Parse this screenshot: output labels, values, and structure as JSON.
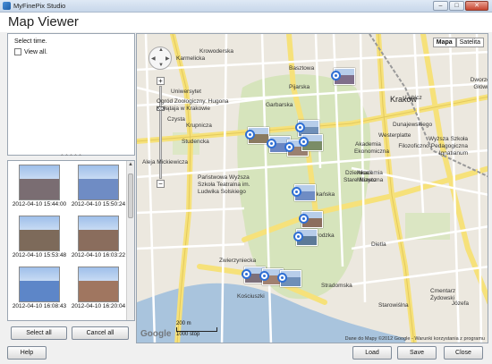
{
  "window": {
    "title": "MyFinePix Studio",
    "buttons": [
      "–",
      "□",
      "✕"
    ]
  },
  "header": {
    "page_title": "Map Viewer"
  },
  "time_panel": {
    "label": "Select time.",
    "view_all_label": "View all.",
    "view_all_checked": false
  },
  "thumbnails": [
    {
      "caption": "2012-04-10 15:44:00",
      "color": "#7a6d72"
    },
    {
      "caption": "2012-04-10 15:50:24",
      "color": "#6f8cc4"
    },
    {
      "caption": "2012-04-10 15:53:48",
      "color": "#7d6a5a"
    },
    {
      "caption": "2012-04-10 16:03:22",
      "color": "#8a6d5d"
    },
    {
      "caption": "2012-04-10 16:08:43",
      "color": "#5d86c8"
    },
    {
      "caption": "2012-04-10 16:20:04",
      "color": "#a07660"
    }
  ],
  "left_buttons": {
    "select_all": "Select all",
    "cancel_all": "Cancel all"
  },
  "map": {
    "types": [
      "Mapa",
      "Satelita"
    ],
    "active_type": "Mapa",
    "labels": [
      {
        "text": "Kraków",
        "class": "city"
      },
      {
        "text": "Uniwersytet"
      },
      {
        "text": "Ogród Zoologiczny. Hugona"
      },
      {
        "text": "Kołłątaja w Krakowie"
      },
      {
        "text": "Czysta"
      },
      {
        "text": "Krupnicza"
      },
      {
        "text": "Studencka"
      },
      {
        "text": "Państwowa Wyższa"
      },
      {
        "text": "Szkoła Teatralna im."
      },
      {
        "text": "Ludwika Solskiego"
      },
      {
        "text": "Dzielnica I"
      },
      {
        "text": "Stare Miasto"
      },
      {
        "text": "Akademia"
      },
      {
        "text": "Ekonomiczna"
      },
      {
        "text": "Akademia"
      },
      {
        "text": "Muzyczna"
      },
      {
        "text": "Wyższa Szkoła"
      },
      {
        "text": "Filozoficzno-Pedagogiczna"
      },
      {
        "text": "Ignatianum"
      },
      {
        "text": "Cmentarz"
      },
      {
        "text": "Żydowski"
      },
      {
        "text": "Dworzec"
      },
      {
        "text": "Główny"
      },
      {
        "text": "Basztowa"
      },
      {
        "text": "Pijarska"
      },
      {
        "text": "Garbarska"
      },
      {
        "text": "Dunajewskiego"
      },
      {
        "text": "Westerplatte"
      },
      {
        "text": "Lubicz"
      },
      {
        "text": "Franciszkańska"
      },
      {
        "text": "Grodzka"
      },
      {
        "text": "Stradomska"
      },
      {
        "text": "Dietla"
      },
      {
        "text": "Józefa"
      },
      {
        "text": "Krowoderska"
      },
      {
        "text": "Karmelicka"
      },
      {
        "text": "Aleja Mickiewicza"
      },
      {
        "text": "Zwierzyniecka"
      },
      {
        "text": "Kościuszki"
      },
      {
        "text": "Starowiślna"
      }
    ],
    "scale": {
      "metric": "200 m",
      "imperial": "1000 stóp"
    },
    "google": "Google",
    "attribution": "Dane do Mapy ©2012 Google - Warunki korzystania z programu"
  },
  "footer": {
    "help": "Help",
    "load": "Load",
    "save": "Save",
    "close": "Close"
  }
}
